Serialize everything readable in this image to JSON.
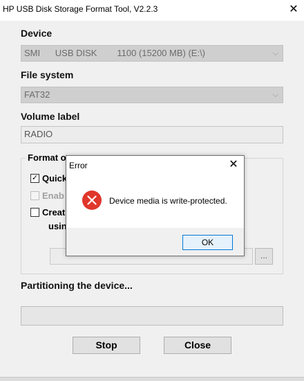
{
  "window": {
    "title": "HP USB Disk Storage Format Tool, V2.2.3",
    "close_glyph": "✕"
  },
  "device": {
    "label": "Device",
    "value": "SMI      USB DISK        1100 (15200 MB) (E:\\)"
  },
  "file_system": {
    "label": "File system",
    "value": "FAT32"
  },
  "volume_label": {
    "label": "Volume label",
    "value": "RADIO"
  },
  "format_options": {
    "title": "Format o",
    "options": [
      {
        "label": "Quick",
        "checked": true,
        "enabled": true
      },
      {
        "label": "Enab",
        "checked": false,
        "enabled": false
      },
      {
        "label": "Creat",
        "checked": false,
        "enabled": true,
        "line2": "usin"
      }
    ],
    "browse_button": "..."
  },
  "status_text": "Partitioning the device...",
  "buttons": {
    "stop": "Stop",
    "close": "Close"
  },
  "dialog": {
    "title": "Error",
    "message": "Device media is write-protected.",
    "ok": "OK",
    "icon": "error-icon",
    "close_glyph": "✕"
  },
  "colors": {
    "error_red": "#e0362b",
    "accent": "#0078d7"
  }
}
